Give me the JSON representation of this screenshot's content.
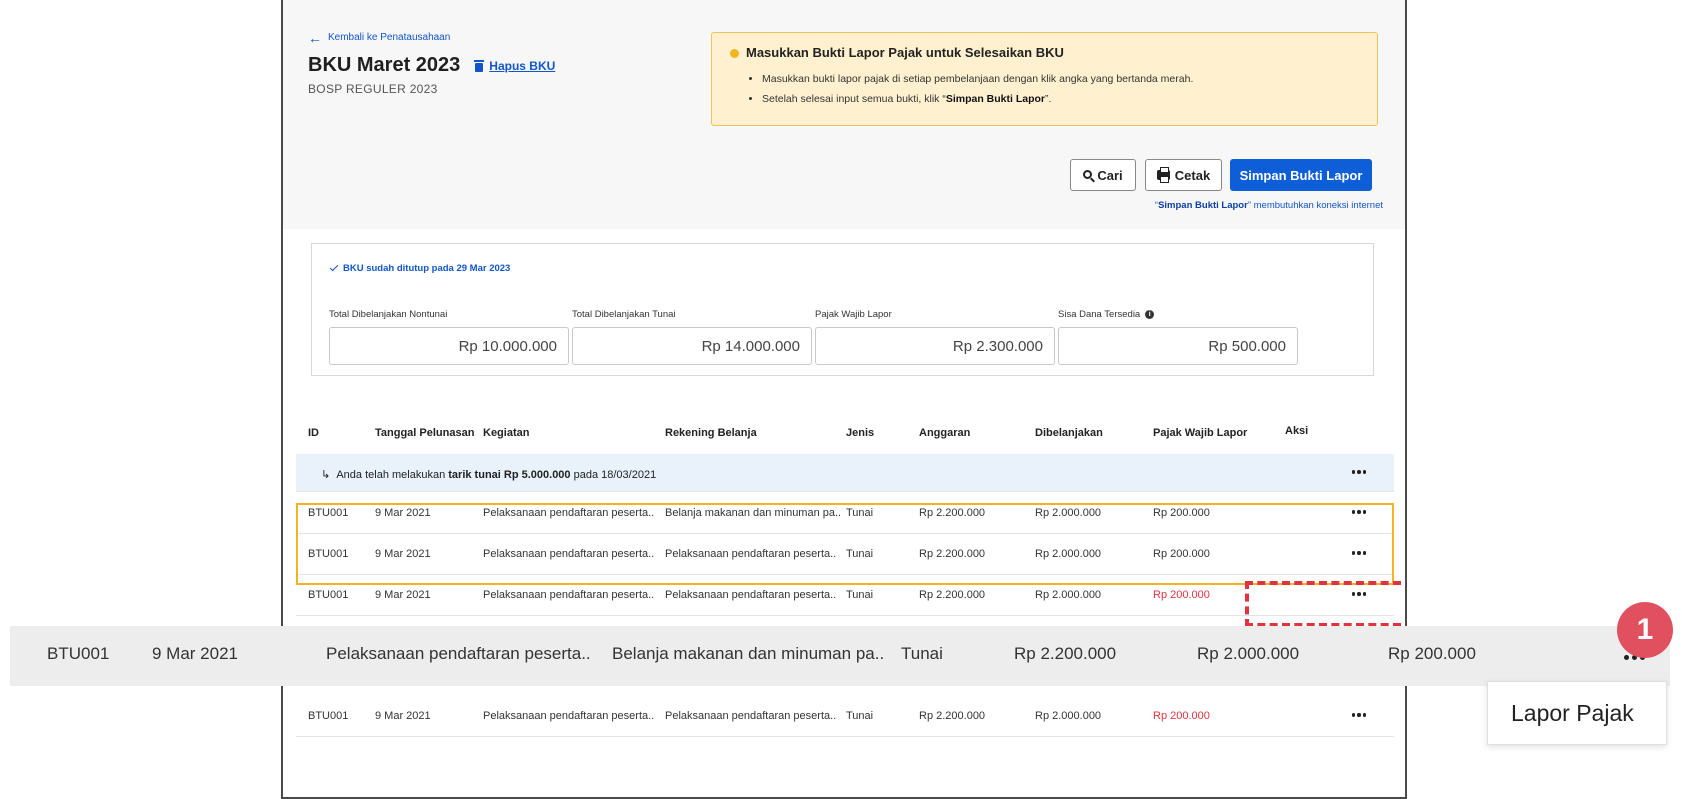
{
  "header": {
    "back_label": "Kembali ke Penatausahaan",
    "title": "BKU Maret 2023",
    "delete_label": "Hapus BKU",
    "subtitle": "BOSP REGULER 2023"
  },
  "notice": {
    "title": "Masukkan Bukti Lapor Pajak untuk Selesaikan BKU",
    "item1": "Masukkan bukti lapor pajak di setiap pembelanjaan dengan klik angka yang bertanda merah.",
    "item2_pre": "Setelah selesai input semua bukti, klik “",
    "item2_bold": "Simpan Bukti Lapor",
    "item2_post": "”."
  },
  "toolbar": {
    "search_label": "Cari",
    "print_label": "Cetak",
    "save_label": "Simpan Bukti Lapor",
    "hint_pre": "“",
    "hint_bold": "Simpan Bukti Lapor",
    "hint_post": "” membutuhkan koneksi internet"
  },
  "summary": {
    "closed_text": "BKU sudah ditutup pada 29 Mar 2023",
    "metrics": [
      {
        "label": "Total Dibelanjakan Nontunai",
        "value": "Rp 10.000.000"
      },
      {
        "label": "Total Dibelanjakan Tunai",
        "value": "Rp 14.000.000"
      },
      {
        "label": "Pajak Wajib Lapor",
        "value": "Rp 2.300.000"
      },
      {
        "label": "Sisa Dana Tersedia",
        "value": "Rp 500.000"
      }
    ]
  },
  "table": {
    "headers": [
      "ID",
      "Tanggal Pelunasan",
      "Kegiatan",
      "Rekening Belanja",
      "Jenis",
      "Anggaran",
      "Dibelanjakan",
      "Pajak Wajib Lapor",
      "Aksi"
    ],
    "info_pre": "Anda telah melakukan ",
    "info_bold": "tarik tunai Rp 5.000.000",
    "info_post": " pada 18/03/2021",
    "info_arrow": "↳",
    "rows": [
      [
        "BTU001",
        "9 Mar 2021",
        "Pelaksanaan pendaftaran peserta..",
        "Belanja makanan dan minuman pa..",
        "Tunai",
        "Rp 2.200.000",
        "Rp 2.000.000",
        "Rp 200.000"
      ],
      [
        "BTU001",
        "9 Mar 2021",
        "Pelaksanaan pendaftaran peserta..",
        "Pelaksanaan pendaftaran peserta..",
        "Tunai",
        "Rp 2.200.000",
        "Rp 2.000.000",
        "Rp 200.000"
      ],
      [
        "BTU001",
        "9 Mar 2021",
        "Pelaksanaan pendaftaran peserta..",
        "Pelaksanaan pendaftaran peserta..",
        "Tunai",
        "Rp 2.200.000",
        "Rp 2.000.000",
        "Rp 200.000"
      ],
      [
        "BTU001",
        "9 Mar 2021",
        "Pelaksanaan pendaftaran peserta..",
        "Pelaksanaan pendaftaran peserta..",
        "Tunai",
        "Rp 2.200.000",
        "Rp 2.000.000",
        "Rp 200.000"
      ]
    ]
  },
  "zoom_row": [
    "BTU001",
    "9 Mar 2021",
    "Pelaksanaan pendaftaran peserta..",
    "Belanja makanan dan minuman pa..",
    "Tunai",
    "Rp 2.200.000",
    "Rp 2.000.000",
    "Rp 200.000"
  ],
  "callout": {
    "badge": "1",
    "menu_item": "Lapor Pajak"
  },
  "colors": {
    "primary": "#0d5ed7",
    "tax_red": "#e0333f",
    "notice_bg": "#fff1d0",
    "highlight": "#f5b324"
  }
}
